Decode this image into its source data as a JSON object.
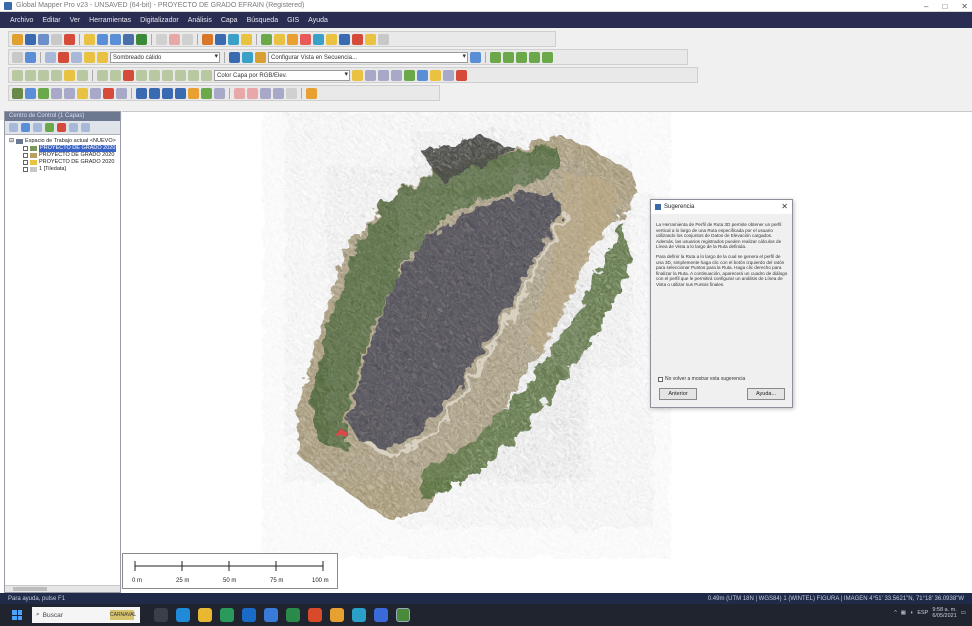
{
  "window": {
    "title": "Global Mapper Pro v23 - UNSAVED (64-bit) - PROYECTO DE GRADO EFRAIN (Registered)",
    "controls": [
      "–",
      "□",
      "✕"
    ]
  },
  "menu": {
    "items": [
      "Archivo",
      "Editar",
      "Ver",
      "Herramientas",
      "Digitalizador",
      "Análisis",
      "Capa",
      "Búsqueda",
      "GIS",
      "Ayuda"
    ]
  },
  "toolbar": {
    "combo_theme": "Sombreado cálido",
    "combo_config": "Configurar Vista en Secuencia...",
    "combo_color": "Color Capa por RGB/Elev."
  },
  "control_center": {
    "header": "Centro de Control (1 Capas)",
    "tree": [
      {
        "label": "Espacio de Trabajo actual <NUEVO>",
        "selected": false
      },
      {
        "label": "PROYECTO DE GRADO 2020",
        "selected": true
      },
      {
        "label": "PROYECTO DE GRADO 2020",
        "selected": false
      },
      {
        "label": "PROYECTO DE GRADO 2020",
        "selected": false
      },
      {
        "label": "1 [Tiledata]",
        "selected": false
      }
    ]
  },
  "scalebar": {
    "labels": [
      "0 m",
      "25 m",
      "50 m",
      "75 m",
      "100 m"
    ]
  },
  "dialog": {
    "title": "Sugerencia",
    "close": "✕",
    "paragraph1": "La Herramienta de Perfil de Ruta 3D permite obtener un perfil vertical a lo largo de una Ruta especificada por el usuario utilizando los conjuntos de Datos de Elevación cargados. Además, las usuarios registrados pueden realizar cálculos de Línea de Vista a lo largo de la Ruta definida.",
    "paragraph2": "Para definir la Ruta a lo largo de la cual se genera el perfil de una 3D, simplemente haga clic con el botón izquierdo del ratón para seleccionar Puntos para la Ruta. Haga clic derecho para finalizar la Ruta. A continuación, aparecerá un cuadro de diálogo con el perfil que le permitirá configurar un análisis de Línea de Vista o utilizar sus Puntos finales.",
    "checkbox": "No volver a mostrar esta sugerencia",
    "prev_btn": "Anterior",
    "next_btn": "Ayuda..."
  },
  "status": {
    "left": "Para ayuda, pulse F1",
    "right": "0.49m (UTM 18N | WGS84) 1 (WINTEL) FIGURA | IMAGEN   4°51' 33.5621\"N, 71°18' 36.0938\"W"
  },
  "taskbar": {
    "search_placeholder": "Buscar",
    "search_thumb": "CARNAVAL",
    "lang": "ESP",
    "time": "9:58 a. m.",
    "date": "6/05/2021"
  },
  "colors": {
    "menubar": "#2a2d52",
    "statusbar": "#1f2b49",
    "taskbar": "#20242e",
    "selection": "#3a64c8"
  }
}
